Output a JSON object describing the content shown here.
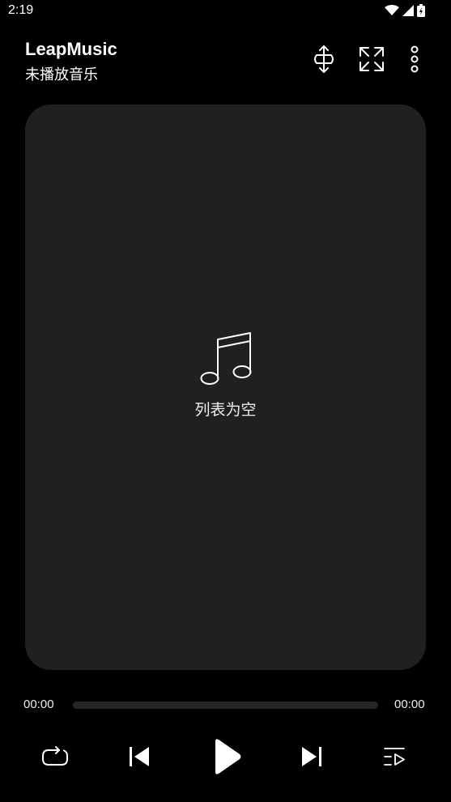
{
  "status_bar": {
    "time": "2:19",
    "icons": [
      "wifi-icon",
      "signal-icon",
      "battery-icon"
    ]
  },
  "header": {
    "title": "LeapMusic",
    "subtitle": "未播放音乐",
    "actions": [
      "rotate-icon",
      "fullscreen-icon",
      "more-vert-icon"
    ]
  },
  "player_card": {
    "empty_icon": "music-note-icon",
    "empty_text": "列表为空"
  },
  "progress": {
    "current_time": "00:00",
    "total_time": "00:00",
    "fraction": 0
  },
  "controls": [
    "repeat-icon",
    "previous-icon",
    "play-icon",
    "next-icon",
    "playlist-icon"
  ],
  "colors": {
    "background": "#000000",
    "card": "#202020",
    "track": "#262626",
    "text": "#ffffff"
  }
}
